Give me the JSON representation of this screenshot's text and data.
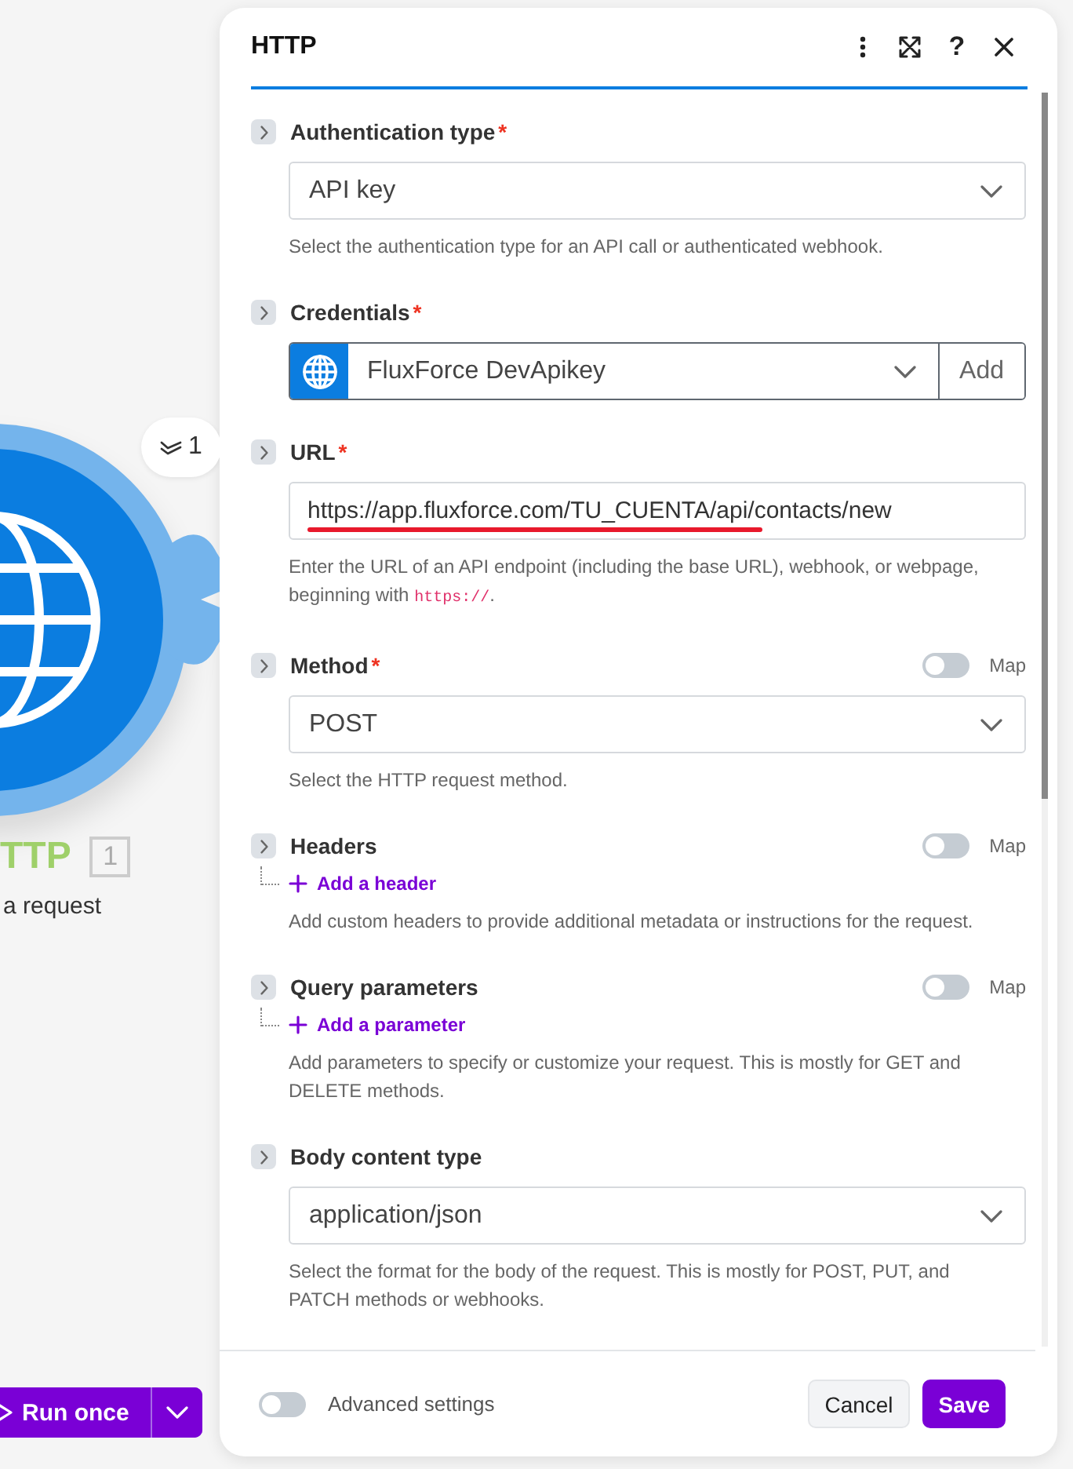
{
  "canvas": {
    "node_title": "TTP",
    "node_badge": "1",
    "node_subtitle": "a request",
    "ops_count": "1",
    "run_button": "Run once"
  },
  "panel": {
    "title": "HTTP",
    "help_glyph": "?",
    "fields": [
      {
        "kind": "select",
        "label": "Authentication type",
        "required_mark": "*",
        "value": "API key",
        "help": "Select the authentication type for an API call or authenticated webhook."
      },
      {
        "kind": "credential",
        "label": "Credentials",
        "required_mark": "*",
        "value": "FluxForce DevApikey",
        "add": "Add"
      },
      {
        "kind": "text",
        "label": "URL",
        "required_mark": "*",
        "value": "https://app.fluxforce.com/TU_CUENTA/api/contacts/new",
        "underlined": true,
        "help": "Enter the URL of an API endpoint (including the base URL), webhook, or webpage, beginning with ",
        "help_code": "https://",
        "help_end": "."
      },
      {
        "kind": "select",
        "label": "Method",
        "required_mark": "*",
        "map": {
          "label": "Map",
          "on": false
        },
        "value": "POST",
        "help": "Select the HTTP request method."
      },
      {
        "kind": "list",
        "label": "Headers",
        "map": {
          "label": "Map",
          "on": false
        },
        "add_link": "Add a header",
        "help": "Add custom headers to provide additional metadata or instructions for the request."
      },
      {
        "kind": "list",
        "label": "Query parameters",
        "map": {
          "label": "Map",
          "on": false
        },
        "add_link": "Add a parameter",
        "help": "Add parameters to specify or customize your request. This is mostly for GET and DELETE methods."
      },
      {
        "kind": "select",
        "label": "Body content type",
        "value": "application/json",
        "help": "Select the format for the body of the request. This is mostly for POST, PUT, and PATCH methods or webhooks."
      }
    ],
    "advanced": {
      "label": "Advanced settings",
      "on": false
    },
    "buttons": [
      {
        "label": "Cancel",
        "kind": "secondary"
      },
      {
        "label": "Save",
        "kind": "primary"
      }
    ]
  }
}
